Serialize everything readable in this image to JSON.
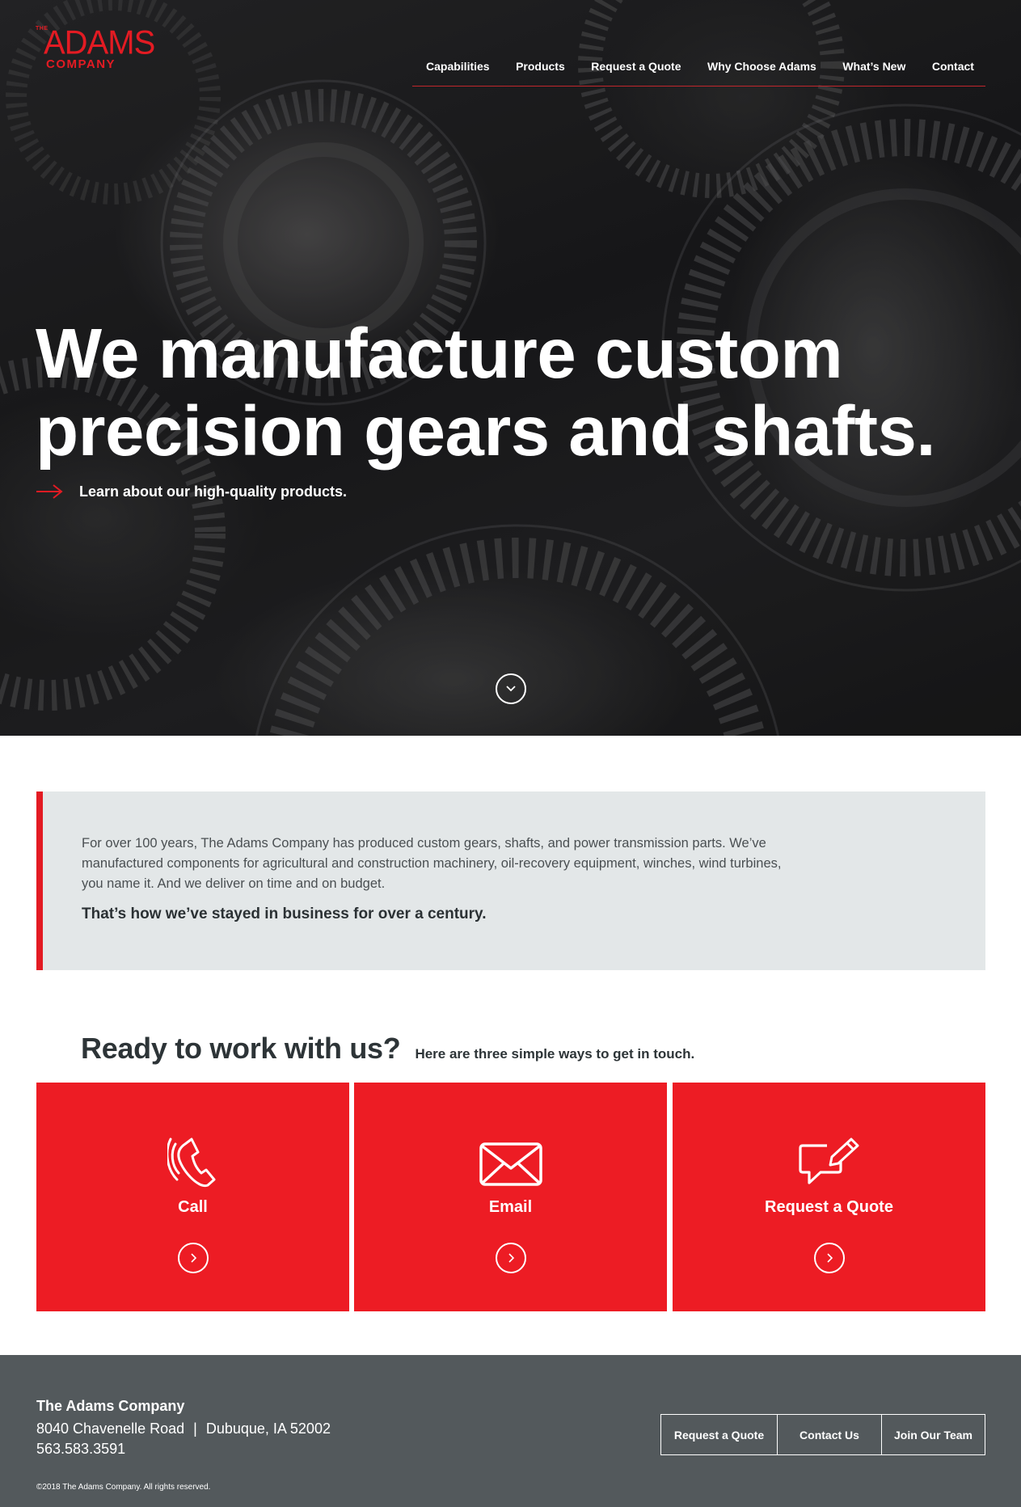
{
  "brand": {
    "logo_small": "THE",
    "logo_main": "ADAMS",
    "logo_sub": "COMPANY",
    "color": "#ed1c24"
  },
  "nav": {
    "items": [
      "Capabilities",
      "Products",
      "Request a Quote",
      "Why Choose Adams",
      "What’s New",
      "Contact"
    ]
  },
  "hero": {
    "headline_line1": "We manufacture custom",
    "headline_line2": "precision gears and shafts.",
    "cta": "Learn about our high-quality products.",
    "arrow_icon": "arrow-right-icon",
    "scroll_icon": "chevron-down-icon"
  },
  "intro": {
    "body": "For over 100 years, The Adams Company has produced custom gears, shafts, and power transmission parts. We’ve manufactured components for agricultural and construction machinery, oil-recovery equipment, winches, wind turbines, you name it. And we deliver on time and on budget.",
    "tagline": "That’s how we’ve stayed in business for over a century."
  },
  "contact": {
    "heading": "Ready to work with us?",
    "subheading": "Here are three simple ways to get in touch.",
    "options": [
      {
        "label": "Call",
        "icon": "phone-icon"
      },
      {
        "label": "Email",
        "icon": "envelope-icon"
      },
      {
        "label": "Request a Quote",
        "icon": "chat-pencil-icon"
      }
    ]
  },
  "footer": {
    "company": "The Adams Company",
    "street": "8040 Chavenelle Road",
    "separator": "|",
    "city": "Dubuque, IA 52002",
    "phone": "563.583.3591",
    "copyright": "©2018 The Adams Company. All rights reserved.",
    "buttons": [
      "Request a Quote",
      "Contact Us",
      "Join Our Team"
    ]
  }
}
